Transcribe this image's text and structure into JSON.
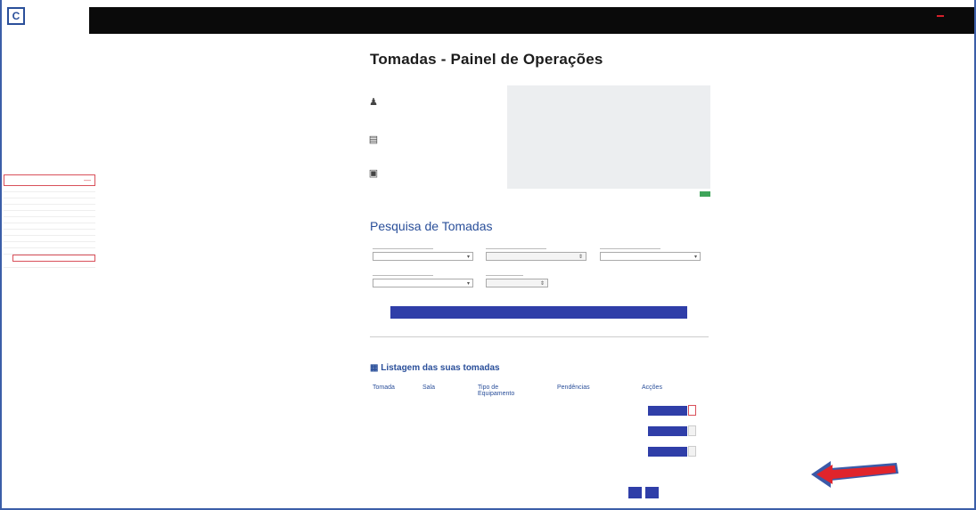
{
  "header": {
    "logo_letter": "C",
    "logo_text": "",
    "title": "",
    "alert_badge": "",
    "links": [
      "",
      "",
      "",
      ""
    ]
  },
  "sidebar": {
    "section_label": "",
    "items": [
      "",
      "",
      "",
      "",
      "",
      "",
      "",
      "",
      "",
      "",
      "",
      "",
      ""
    ]
  },
  "page": {
    "title": "Tomadas - Painel de Operações"
  },
  "operations": {
    "links": [
      "",
      "",
      ""
    ],
    "notes": [
      {
        "title": "",
        "text": ""
      },
      {
        "title": "",
        "text": ""
      },
      {
        "title": "",
        "text": ""
      }
    ],
    "new_request_button": ""
  },
  "search": {
    "title": "Pesquisa de Tomadas",
    "fields": [
      {
        "label": "",
        "value": ""
      },
      {
        "label": "",
        "value": ""
      },
      {
        "label": "",
        "value": ""
      },
      {
        "label": "",
        "value": ""
      },
      {
        "label": "",
        "value": ""
      }
    ],
    "button": ""
  },
  "list": {
    "title": "Listagem das suas tomadas",
    "columns": [
      "Tomada",
      "Sala",
      "Tipo de Equipamento",
      "Pendências",
      "Acções"
    ],
    "rows": [
      {
        "tipo": "",
        "pendencias": "",
        "action": ""
      },
      {
        "tipo": "",
        "pendencias": "",
        "action": ""
      },
      {
        "tipo": "",
        "pendencias": "",
        "action": ""
      }
    ],
    "pagination_text": "",
    "page_buttons": [
      "",
      ""
    ]
  },
  "colors": {
    "accent_blue": "#2f3ea8",
    "link_blue": "#3e63a8",
    "success_green": "#3fa55a",
    "alert_red": "#d61f2a"
  }
}
